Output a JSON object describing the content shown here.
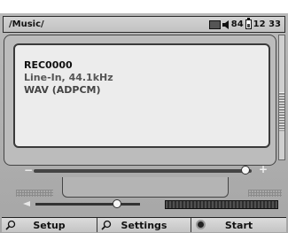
{
  "status_bar": {
    "path": "/Music/",
    "battery_level": "84",
    "clock": "12 33",
    "icons": [
      "hard-disk-icon",
      "speaker-icon",
      "battery-icon"
    ]
  },
  "track_info": {
    "name": "REC0000",
    "source": "Line-In, 44.1kHz",
    "format": "WAV (ADPCM)"
  },
  "progress": {
    "minus_label": "−",
    "plus_label": "+",
    "position_fraction": 0.97
  },
  "volume": {
    "level_fraction": 0.78
  },
  "softkeys": [
    {
      "label": "Setup",
      "icon": "magnifier-icon"
    },
    {
      "label": "Settings",
      "icon": "magnifier-icon"
    },
    {
      "label": "Start",
      "icon": "record-icon"
    }
  ],
  "colors": {
    "screen_bg": "#ececec",
    "device_bg": "#b0b0b0",
    "accent_dark": "#333333"
  }
}
